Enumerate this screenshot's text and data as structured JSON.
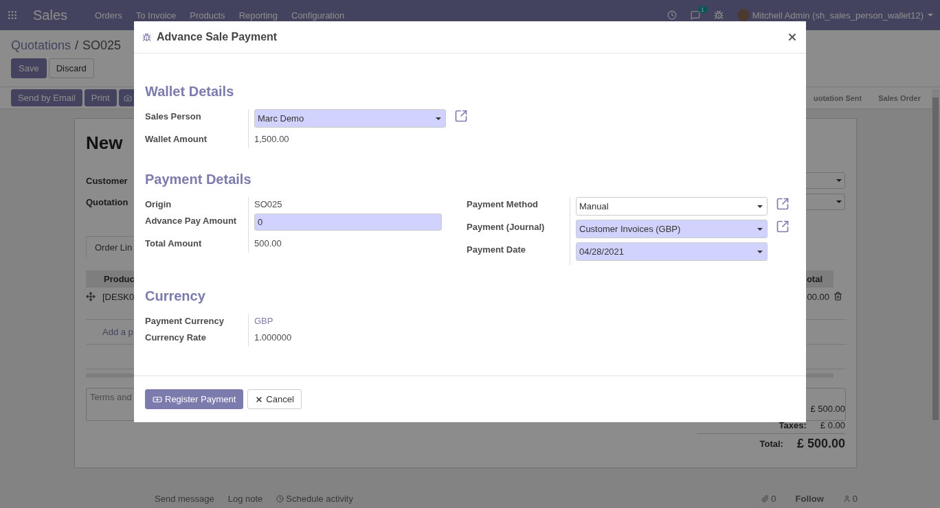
{
  "navbar": {
    "app": "Sales",
    "menu": [
      "Orders",
      "To Invoice",
      "Products",
      "Reporting",
      "Configuration"
    ],
    "chat_count": "1",
    "user": "Mitchell Admin (sh_sales_person_wallet12)"
  },
  "breadcrumb": [
    "Quotations",
    "SO025"
  ],
  "breadcrumb_separator": "/",
  "form_buttons": [
    "Save",
    "Discard"
  ],
  "action_buttons": [
    "Send by Email",
    "Print"
  ],
  "status_steps": [
    "uotation Sent",
    "Sales Order"
  ],
  "sheet": {
    "title": "New",
    "fields": [
      "Customer",
      "Quotation"
    ],
    "tab": "Order Lin",
    "columns": [
      "Produc",
      "otal"
    ],
    "row": [
      "[DESK0",
      "00.00"
    ],
    "add_line": "Add a p",
    "terms": "Terms and",
    "totals": [
      {
        "value": "£ 500.00",
        "kind": "line"
      },
      {
        "label": "Taxes:",
        "value": "£ 0.00",
        "kind": "line"
      },
      {
        "label": "Total:",
        "value": "£ 500.00",
        "kind": "grand"
      }
    ]
  },
  "chatter": {
    "actions": [
      "Send message",
      "Log note",
      "Schedule activity"
    ],
    "attachments": "0",
    "follow": "Follow",
    "followers": "0"
  },
  "dialog": {
    "title": "Advance Sale Payment",
    "sections": [
      {
        "title": "Wallet Details",
        "columns": [
          [
            {
              "label": "Sales Person",
              "kind": "select",
              "value": "Marc Demo",
              "required": true,
              "external_link": true
            },
            {
              "label": "Wallet Amount",
              "kind": "text",
              "value": "1,500.00"
            }
          ]
        ]
      },
      {
        "title": "Payment Details",
        "columns": [
          [
            {
              "label": "Origin",
              "kind": "text",
              "value": "SO025"
            },
            {
              "label": "Advance Pay Amount",
              "kind": "input",
              "value": "0",
              "required": true
            },
            {
              "label": "Total Amount",
              "kind": "text",
              "value": "500.00"
            }
          ],
          [
            {
              "label": "Payment Method",
              "kind": "select",
              "value": "Manual",
              "required": false,
              "external_link": true
            },
            {
              "label": "Payment (Journal)",
              "kind": "select",
              "value": "Customer Invoices (GBP)",
              "required": true,
              "external_link": true
            },
            {
              "label": "Payment Date",
              "kind": "select",
              "value": "04/28/2021",
              "required": true
            }
          ]
        ]
      },
      {
        "title": "Currency",
        "columns": [
          [
            {
              "label": "Payment Currency",
              "kind": "link",
              "value": "GBP"
            },
            {
              "label": "Currency Rate",
              "kind": "text",
              "value": "1.000000"
            }
          ]
        ]
      }
    ],
    "buttons": [
      {
        "label": "Register Payment",
        "kind": "primary"
      },
      {
        "label": "Cancel",
        "kind": "secondary"
      }
    ]
  }
}
